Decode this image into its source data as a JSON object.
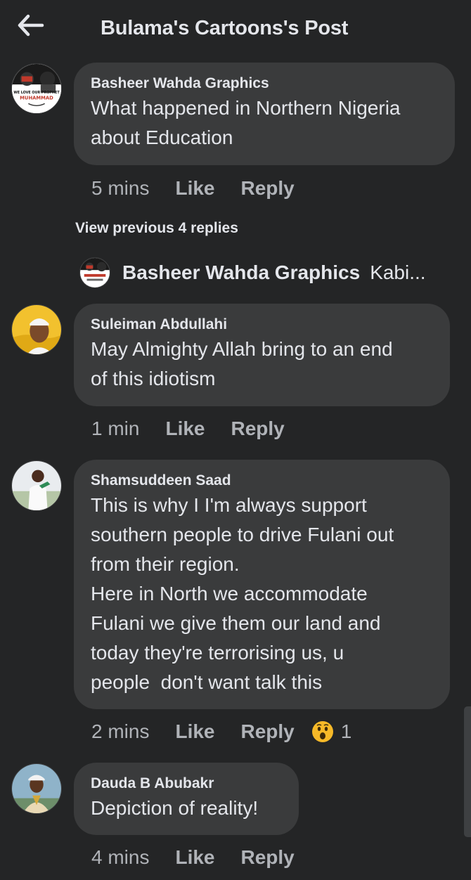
{
  "header": {
    "title": "Bulama's Cartoons's Post"
  },
  "avatar_text": {
    "line1": "WE LOVE OUR PROPHET",
    "line2": "MUHAMMAD"
  },
  "comments": [
    {
      "author": "Basheer Wahda Graphics",
      "text": "What happened in Northern Nigeria\nabout Education",
      "time": "5 mins",
      "like": "Like",
      "reply": "Reply"
    },
    {
      "author": "Suleiman Abdullahi",
      "text": "May Almighty Allah bring to an end\nof this idiotism",
      "time": "1 min",
      "like": "Like",
      "reply": "Reply"
    },
    {
      "author": "Shamsuddeen Saad",
      "text": "This is why I I'm always support\nsouthern people to drive Fulani out\nfrom their region.\nHere in North we accommodate\nFulani we give them our land and\ntoday they're terrorising us, u\npeople  don't want talk this",
      "time": "2 mins",
      "like": "Like",
      "reply": "Reply",
      "reaction": {
        "icon": "wow-emoji-icon",
        "count": "1"
      }
    },
    {
      "author": "Dauda B Abubakr",
      "text": "Depiction of reality!",
      "time": "4 mins",
      "like": "Like",
      "reply": "Reply"
    }
  ],
  "view_previous": "View previous 4 replies",
  "reply_preview": {
    "author": "Basheer Wahda Graphics",
    "snippet": "Kabi..."
  },
  "colors": {
    "background": "#242526",
    "bubble": "#3a3b3c",
    "primary_text": "#e4e6eb",
    "secondary_text": "#b0b3b8"
  }
}
